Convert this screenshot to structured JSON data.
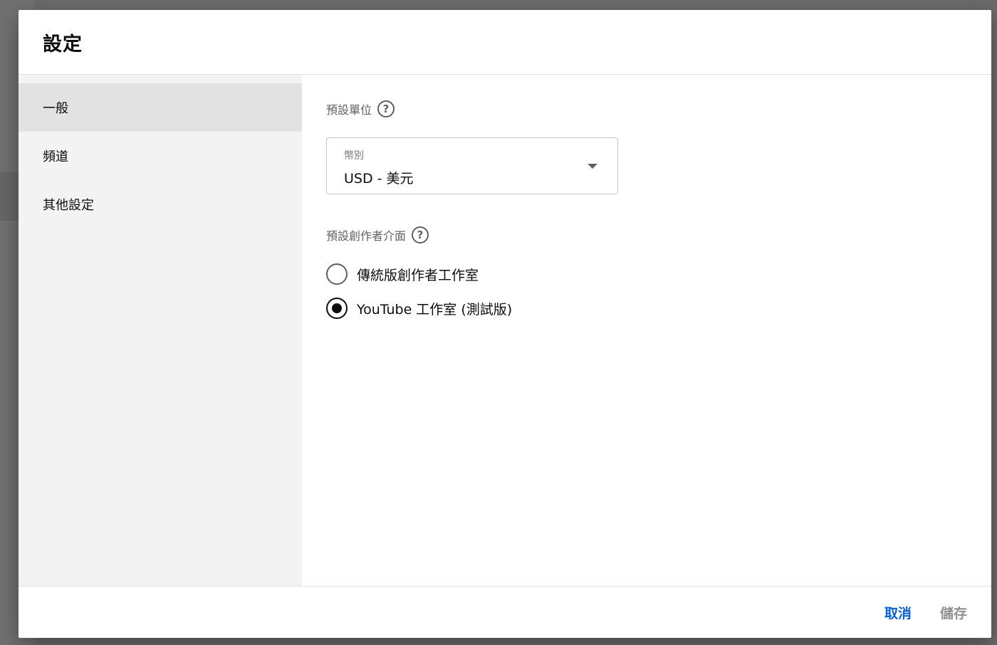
{
  "dialog": {
    "title": "設定"
  },
  "sidebar": {
    "items": [
      {
        "label": "一般",
        "active": true
      },
      {
        "label": "頻道",
        "active": false
      },
      {
        "label": "其他設定",
        "active": false
      }
    ]
  },
  "general": {
    "units_label": "預設單位",
    "currency": {
      "caption": "幣別",
      "value": "USD - 美元"
    },
    "studio_label": "預設創作者介面",
    "studio_options": [
      {
        "label": "傳統版創作者工作室",
        "selected": false
      },
      {
        "label": "YouTube 工作室 (測試版)",
        "selected": true
      }
    ],
    "help_glyph": "?"
  },
  "footer": {
    "cancel_label": "取消",
    "save_label": "儲存"
  },
  "colors": {
    "accent": "#065fd4",
    "disabled_text": "#909090",
    "sidebar_bg": "#f3f3f3",
    "active_item_bg": "#e2e2e2"
  }
}
